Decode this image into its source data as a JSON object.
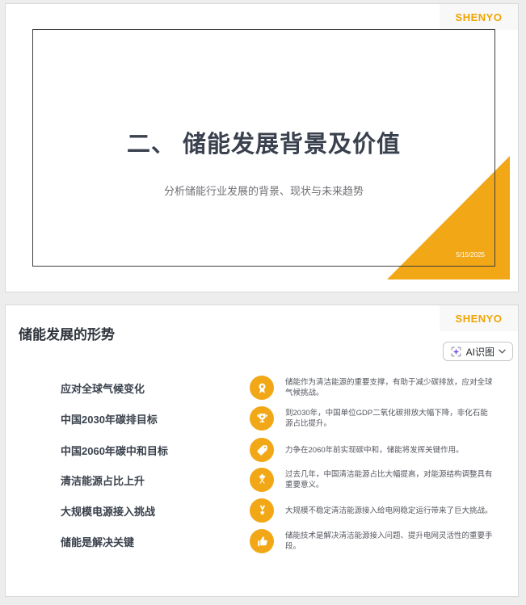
{
  "colors": {
    "accent": "#F2A816",
    "brand": "#F0A400",
    "title_dark": "#39404E",
    "header_dark": "#2F353C",
    "label_dark": "#3A414C",
    "body_gray": "#54575E",
    "subtitle_gray": "#6F7075",
    "frame_border": "#3F3F3F",
    "card_border": "#D9D9D9",
    "page_bg": "#EDEDED",
    "logo_block_bg": "#F8F8F9",
    "btn_border": "#C8C8C8",
    "btn_text": "#24292F"
  },
  "slide1": {
    "logo": "SHENYO",
    "title": "二、 储能发展背景及价值",
    "subtitle": "分析储能行业发展的背景、现状与未来趋势",
    "date": "5/15/2025"
  },
  "slide2": {
    "logo": "SHENYO",
    "title": "储能发展的形势",
    "ai_button": {
      "label": "AI识图",
      "icon": "ai-scan-sparkle-icon",
      "chevron": "chevron-down-icon"
    },
    "rows": [
      {
        "label": "应对全球气候变化",
        "icon": "award-rosette-icon",
        "desc": "储能作为清洁能源的重要支撑，有助于减少碳排放，应对全球气候挑战。"
      },
      {
        "label": "中国2030年碳排目标",
        "icon": "trophy-icon",
        "desc": "到2030年，中国单位GDP二氧化碳排放大幅下降，非化石能源占比提升。"
      },
      {
        "label": "中国2060年碳中和目标",
        "icon": "tag-icon",
        "desc": "力争在2060年前实现碳中和，储能将发挥关键作用。"
      },
      {
        "label": "清洁能源占比上升",
        "icon": "crossed-flags-icon",
        "desc": "过去几年，中国清洁能源占比大幅提高，对能源结构调整具有重要意义。"
      },
      {
        "label": "大规模电源接入挑战",
        "icon": "medal-icon",
        "desc": "大规模不稳定清洁能源接入给电网稳定运行带来了巨大挑战。"
      },
      {
        "label": "储能是解决关键",
        "icon": "thumbs-up-icon",
        "desc": "储能技术是解决清洁能源接入问题、提升电网灵活性的重要手段。"
      }
    ]
  }
}
